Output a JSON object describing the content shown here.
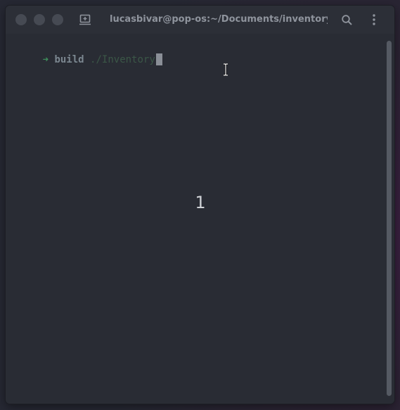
{
  "window": {
    "title": "lucasbivar@pop-os:~/Documents/inventory/bu..."
  },
  "titlebar": {
    "buttons": [
      "close",
      "minimize",
      "maximize"
    ],
    "new_tab_icon": "new-tab-icon",
    "search_icon": "search-icon",
    "menu_icon": "kebab-menu-icon"
  },
  "terminal": {
    "prompt_arrow": "➜",
    "prompt_dir": "build",
    "command": "./Inventory",
    "step_overlay": "1"
  },
  "colors": {
    "prompt_arrow": "#3e8f5c",
    "prompt_dir": "#7b8790",
    "command_text": "#3b5747",
    "background": "#292c34",
    "titlebar": "#2c2f37"
  }
}
